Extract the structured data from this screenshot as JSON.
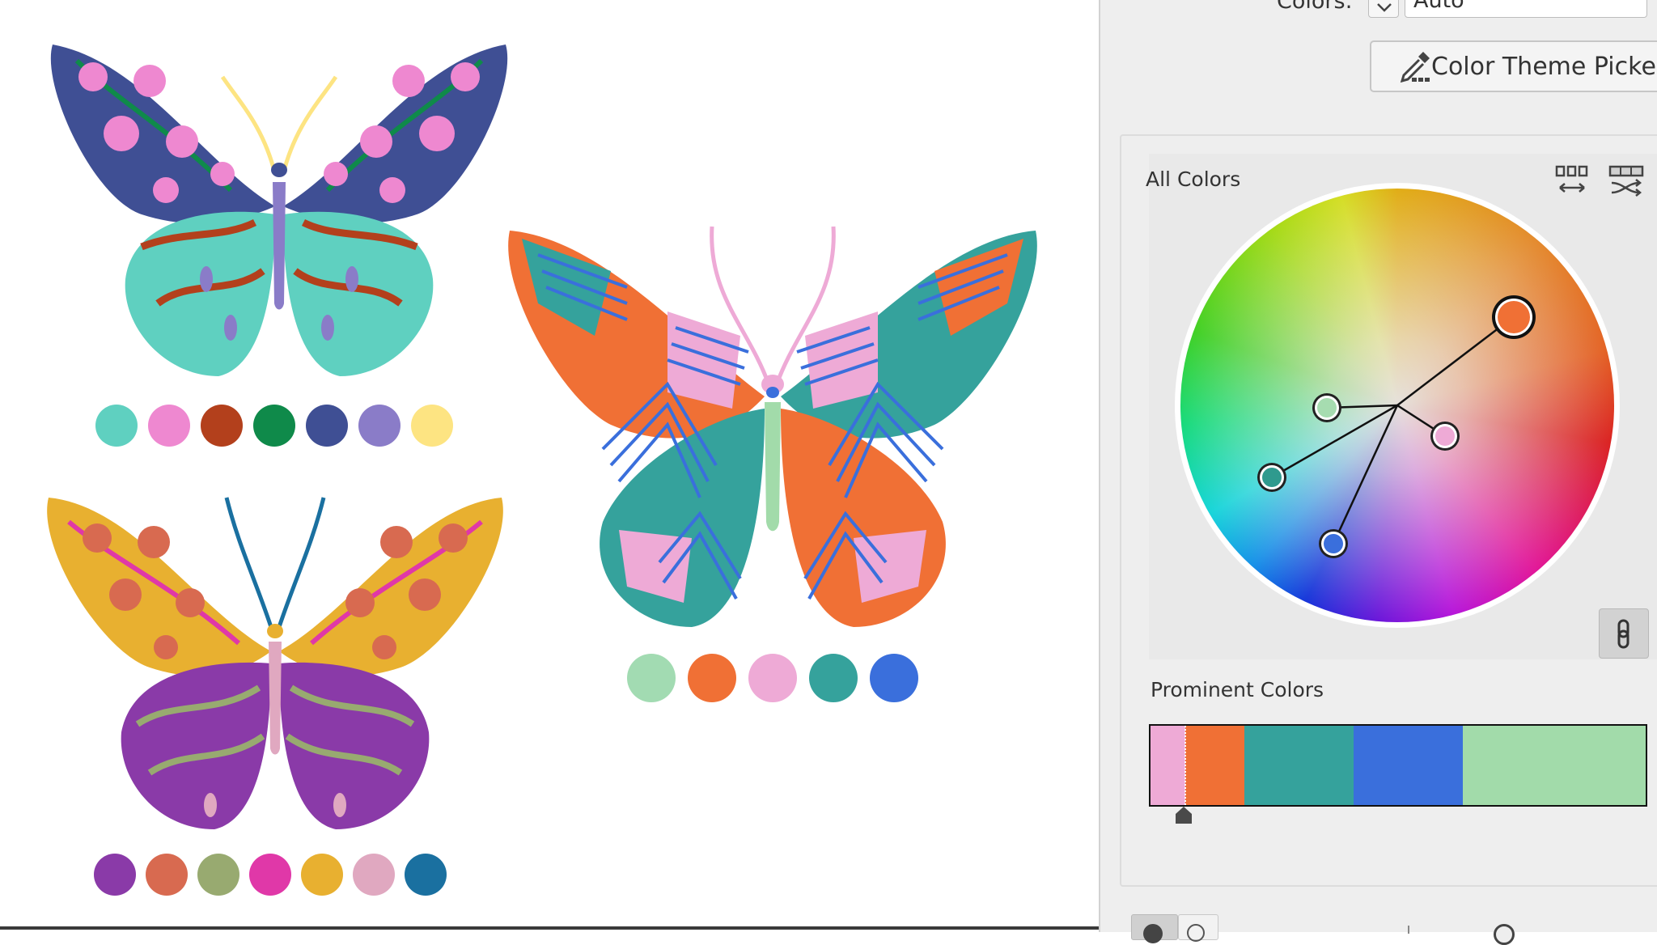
{
  "panel": {
    "colors_label": "Colors:",
    "colors_value": "Auto",
    "color_theme_picker_label": "Color Theme Picker",
    "all_colors_label": "All Colors",
    "prominent_colors_label": "Prominent Colors",
    "prominent_colors": [
      {
        "color": "#eeaad6",
        "share": 0.07
      },
      {
        "color": "#f07035",
        "share": 0.12
      },
      {
        "color": "#35a29c",
        "share": 0.22
      },
      {
        "color": "#3a6fdc",
        "share": 0.22
      },
      {
        "color": "#a2dbaa",
        "share": 0.37
      }
    ],
    "wheel_markers": [
      {
        "color": "#f07035",
        "base": true
      },
      {
        "color": "#a6dcb0",
        "base": false
      },
      {
        "color": "#eeaad6",
        "base": false
      },
      {
        "color": "#2f9a8e",
        "base": false
      },
      {
        "color": "#3a6fdc",
        "base": false
      }
    ]
  },
  "artwork": {
    "butterfly_1_swatches": [
      "#5fd0c0",
      "#ee88d0",
      "#b3401c",
      "#0f8a4a",
      "#3f4f94",
      "#8a7cc8",
      "#fde482"
    ],
    "butterfly_2_swatches": [
      "#a2dbb2",
      "#f07035",
      "#eeaad6",
      "#35a29c",
      "#3a6fdc"
    ],
    "butterfly_3_swatches": [
      "#8a3aa8",
      "#d86a50",
      "#98aa70",
      "#e038a8",
      "#e8b030",
      "#e0a8c0",
      "#1a70a0"
    ]
  },
  "icons": {
    "dropdown": "chevron-down-icon",
    "picker": "eyedropper-icon",
    "arrange": "arrange-swatches-icon",
    "randomize": "randomize-icon",
    "link": "link-icon"
  }
}
